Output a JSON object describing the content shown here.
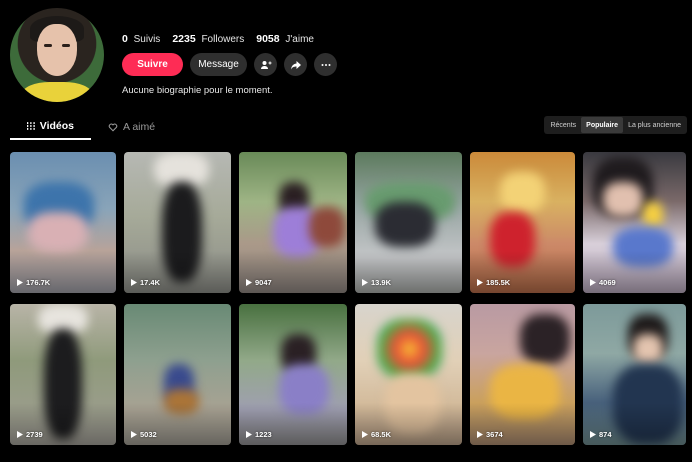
{
  "profile": {
    "stats": [
      {
        "value": "0",
        "label": "Suivis"
      },
      {
        "value": "2235",
        "label": "Followers"
      },
      {
        "value": "9058",
        "label": "J'aime"
      }
    ],
    "follow_label": "Suivre",
    "message_label": "Message",
    "bio": "Aucune biographie pour le moment."
  },
  "tabs": [
    {
      "label": "Vidéos",
      "icon": "grid-icon",
      "active": true
    },
    {
      "label": "A aimé",
      "icon": "heart-outline-icon",
      "active": false
    }
  ],
  "sort": {
    "options": [
      "Récents",
      "Populaire",
      "La plus ancienne"
    ],
    "selected": "Populaire"
  },
  "videos": [
    {
      "views": "176.7K"
    },
    {
      "views": "17.4K"
    },
    {
      "views": "9047"
    },
    {
      "views": "13.9K"
    },
    {
      "views": "185.5K"
    },
    {
      "views": "4069"
    },
    {
      "views": "2739"
    },
    {
      "views": "5032"
    },
    {
      "views": "1223"
    },
    {
      "views": "68.5K"
    },
    {
      "views": "3674"
    },
    {
      "views": "874"
    }
  ],
  "colors": {
    "accent": "#fe2c55",
    "background": "#000000",
    "button_secondary": "#2f2f2f"
  }
}
